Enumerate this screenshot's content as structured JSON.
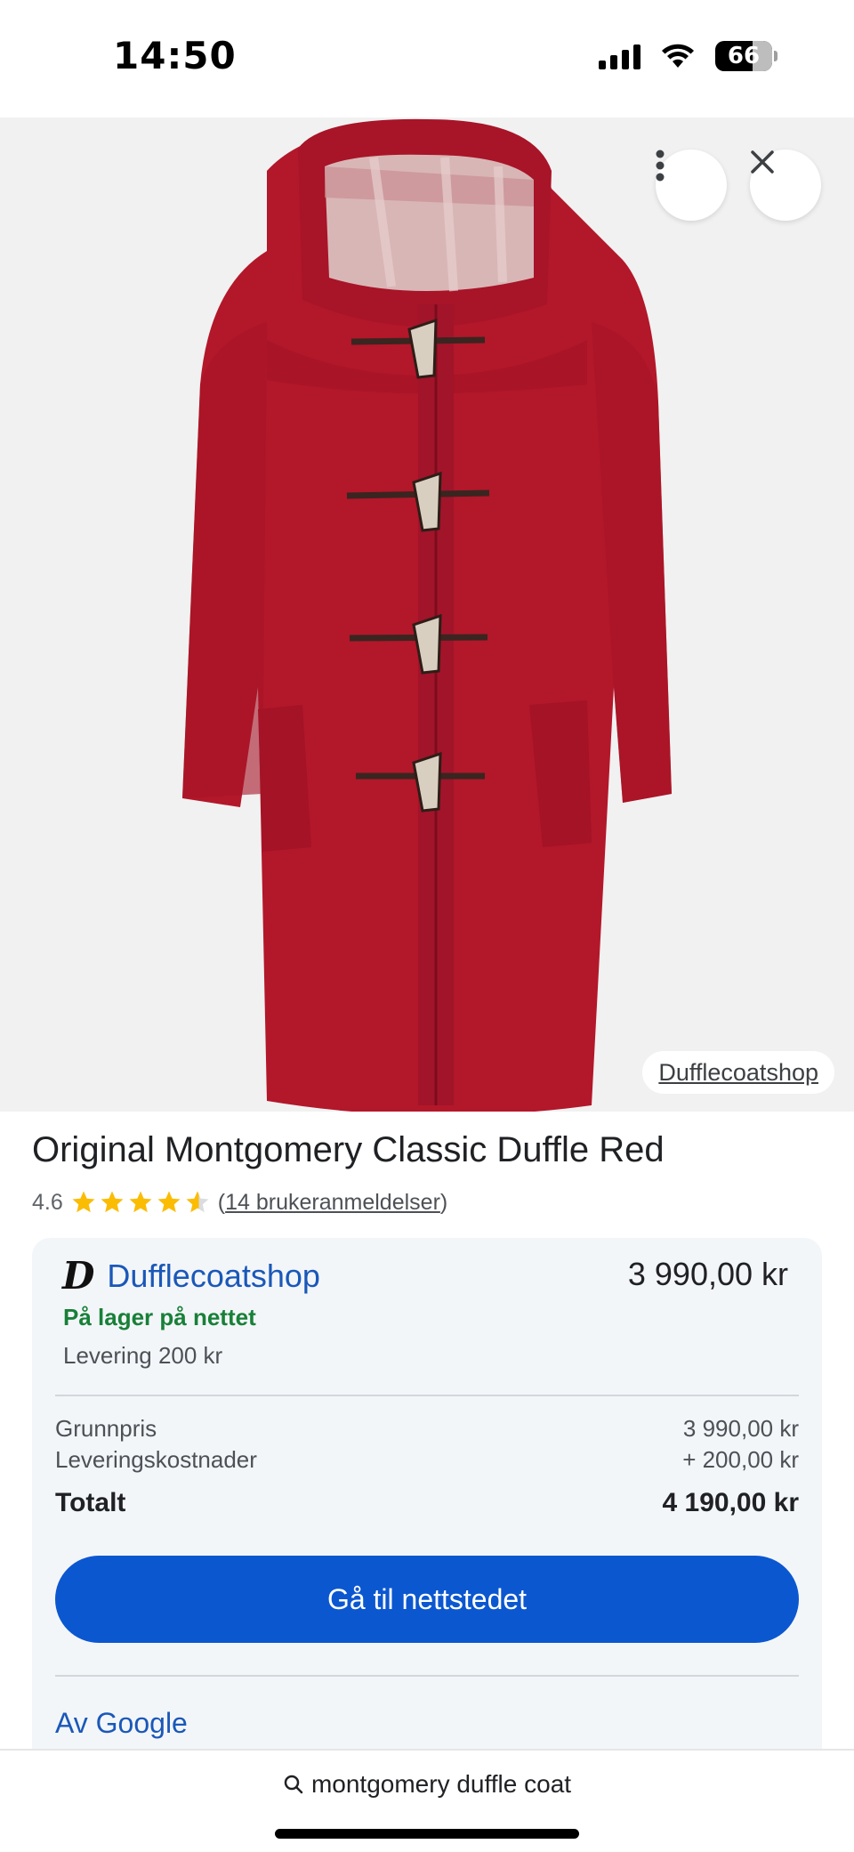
{
  "status_bar": {
    "time": "14:50",
    "battery": "66",
    "icons": [
      "cellular-signal-icon",
      "wifi-icon",
      "battery-icon"
    ]
  },
  "product": {
    "image_alt_icon": "red-duffle-coat-image",
    "source_chip": "Dufflecoatshop",
    "title": "Original Montgomery Classic Duffle Red",
    "rating_value": "4.6",
    "stars": 4.6,
    "reviews_prefix": "(",
    "reviews_text": "14 brukeranmeldelser",
    "reviews_suffix": ")"
  },
  "offer": {
    "seller_logo": "D",
    "seller_name": "Dufflecoatshop",
    "price": "3 990,00 kr",
    "stock": "På lager på nettet",
    "delivery": "Levering 200 kr",
    "base_label": "Grunnpris",
    "base_value": "3 990,00 kr",
    "shipping_label": "Leveringskostnader",
    "shipping_value": "+ 200,00 kr",
    "total_label": "Totalt",
    "total_value": "4 190,00 kr",
    "cta_label": "Gå til nettstedet",
    "by_google": "Av Google"
  },
  "bottom": {
    "search_query": "montgomery duffle coat"
  },
  "colors": {
    "accent": "#0b57d0",
    "link": "#1a58b8",
    "stock": "#188038",
    "star": "#fbbc04",
    "coat": "#b3172a"
  }
}
